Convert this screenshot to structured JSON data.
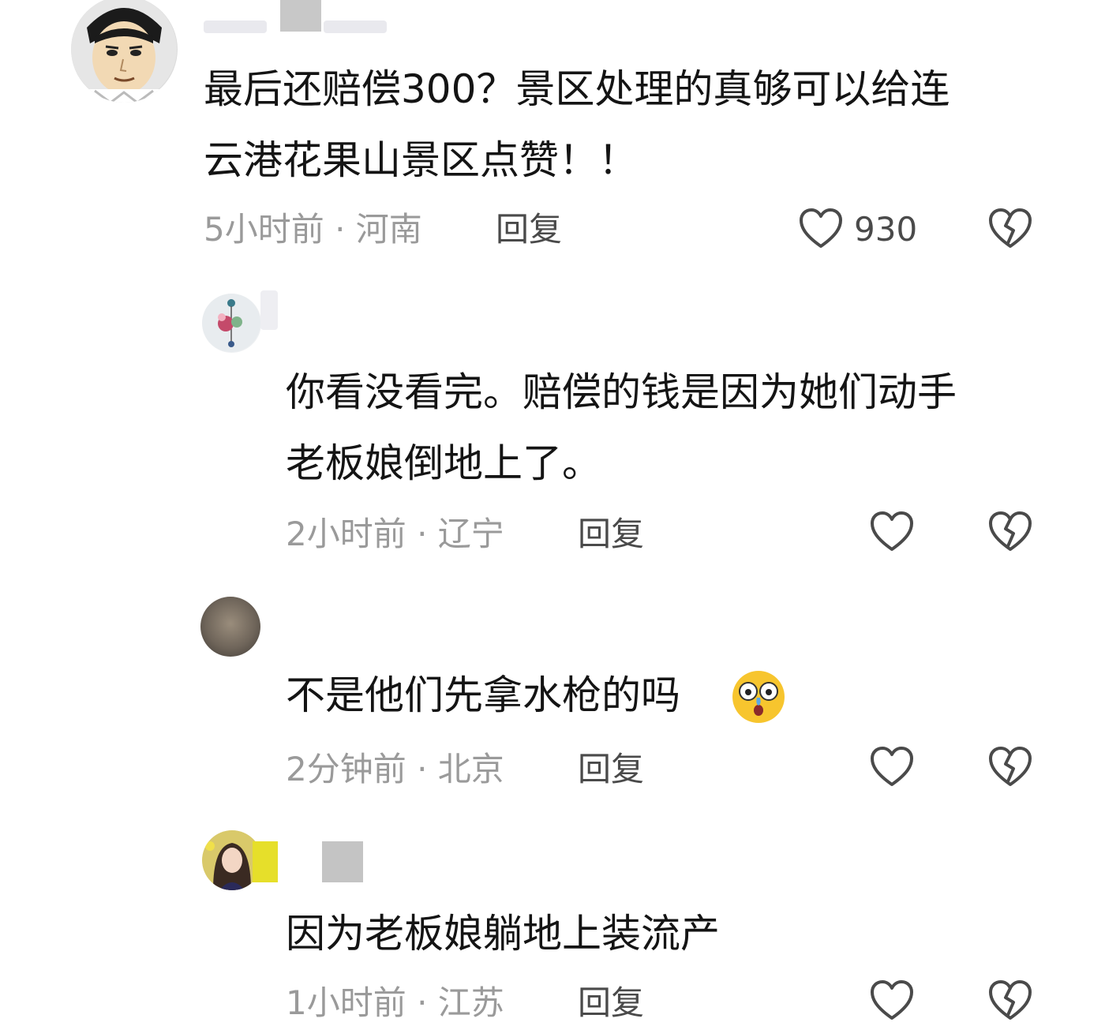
{
  "comments": [
    {
      "text_lines": [
        "最后还赔偿300？景区处理的真够可以给连",
        "云港花果山景区点赞！！"
      ],
      "meta": "5小时前 · 河南",
      "reply_label": "回复",
      "likes": "930"
    },
    {
      "text_lines": [
        "你看没看完。赔偿的钱是因为她们动手",
        "老板娘倒地上了。"
      ],
      "meta": "2小时前 · 辽宁",
      "reply_label": "回复"
    },
    {
      "text_lines": [
        "不是他们先拿水枪的吗"
      ],
      "meta": "2分钟前 · 北京",
      "reply_label": "回复",
      "emoji": "shocked-crying-face"
    },
    {
      "text_lines": [
        "因为老板娘躺地上装流产"
      ],
      "meta": "1小时前 · 江苏",
      "reply_label": "回复"
    }
  ],
  "icons": {
    "like": "heart-outline-icon",
    "dislike": "broken-heart-icon"
  },
  "colors": {
    "text": "#141414",
    "meta": "#9a9a9a",
    "icon": "#4a4a4a",
    "background": "#ffffff"
  }
}
